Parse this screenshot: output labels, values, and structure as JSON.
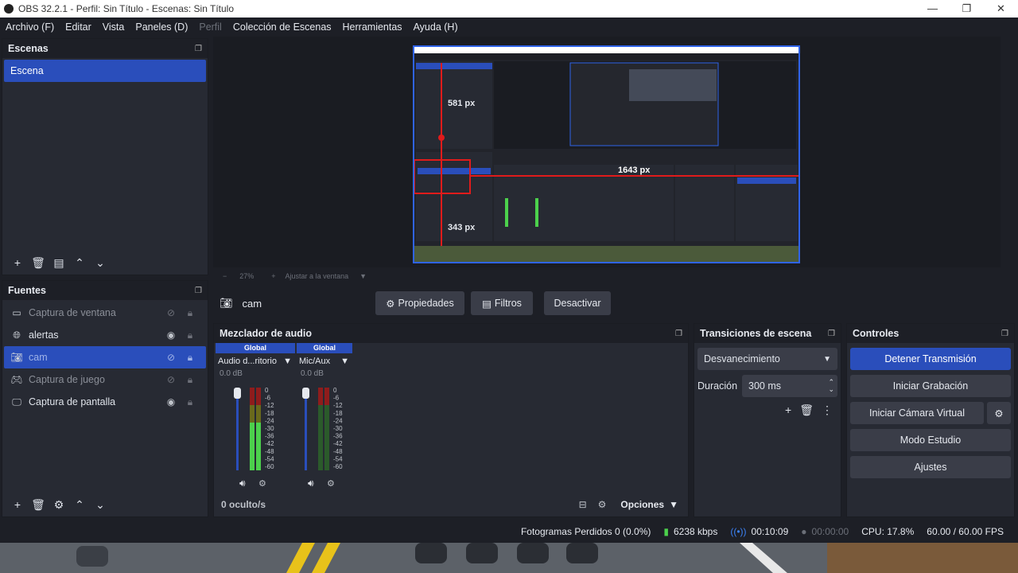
{
  "window": {
    "title": "OBS 32.2.1 - Perfil: Sin Título - Escenas: Sin Título",
    "minimize": "—",
    "maximize": "❐",
    "close": "✕"
  },
  "menu": {
    "items": [
      "Archivo (F)",
      "Editar",
      "Vista",
      "Paneles (D)",
      "Perfil",
      "Colección de Escenas",
      "Herramientas",
      "Ayuda (H)"
    ]
  },
  "scenes": {
    "title": "Escenas",
    "items": [
      "Escena"
    ]
  },
  "sources": {
    "title": "Fuentes",
    "items": [
      {
        "name": "Captura de ventana",
        "icon": "window-icon",
        "visible": false
      },
      {
        "name": "alertas",
        "icon": "globe-icon",
        "visible": true
      },
      {
        "name": "cam",
        "icon": "camera-icon",
        "visible": false
      },
      {
        "name": "Captura de juego",
        "icon": "gamepad-icon",
        "visible": false
      },
      {
        "name": "Captura de pantalla",
        "icon": "monitor-icon",
        "visible": true
      }
    ]
  },
  "preview": {
    "zoom": "27%",
    "fit_label": "Ajustar a la ventana",
    "nested_labels": {
      "top": "581 px",
      "right": "1643 px",
      "bottom": "343 px"
    }
  },
  "context_bar": {
    "source_name": "cam",
    "properties": "Propiedades",
    "filters": "Filtros",
    "deactivate": "Desactivar"
  },
  "mixer": {
    "title": "Mezclador de audio",
    "channels": [
      {
        "badge": "Global",
        "name": "Audio d...ritorio",
        "db": "0.0 dB"
      },
      {
        "badge": "Global",
        "name": "Mic/Aux",
        "db": "0.0 dB"
      }
    ],
    "scale": [
      "0",
      "-6",
      "-12",
      "-18",
      "-24",
      "-30",
      "-36",
      "-42",
      "-48",
      "-54",
      "-60"
    ],
    "hidden_count": "0 oculto/s",
    "options": "Opciones"
  },
  "transitions": {
    "title": "Transiciones de escena",
    "selected": "Desvanecimiento",
    "duration_label": "Duración",
    "duration_value": "300 ms"
  },
  "controls": {
    "title": "Controles",
    "stop_stream": "Detener Transmisión",
    "start_record": "Iniciar Grabación",
    "start_virtual_cam": "Iniciar Cámara Virtual",
    "studio_mode": "Modo Estudio",
    "settings": "Ajustes"
  },
  "status": {
    "dropped_frames": "Fotogramas Perdidos 0 (0.0%)",
    "bitrate": "6238 kbps",
    "stream_time": "00:10:09",
    "record_time": "00:00:00",
    "cpu": "CPU: 17.8%",
    "fps": "60.00 / 60.00 FPS"
  },
  "colors": {
    "accent": "#2a4ebb",
    "panel": "#272a33",
    "background": "#1d1f26",
    "meter_green": "#4cd14c",
    "meter_red": "#8f1c1c"
  }
}
